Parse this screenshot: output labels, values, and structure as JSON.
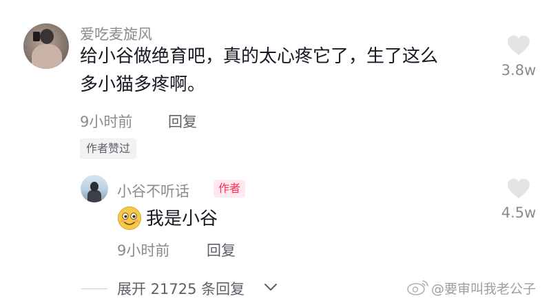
{
  "comment1": {
    "username": "爱吃麦旋风",
    "text_line1": "给小谷做绝育吧，真的太心疼它了，生了这么",
    "text_line2": "多小猫多疼啊。",
    "time": "9小时前",
    "reply_label": "回复",
    "liked_badge": "作者赞过",
    "likes": "3.8w"
  },
  "reply1": {
    "username": "小谷不听话",
    "author_badge": "作者",
    "text": "我是小谷",
    "emoji": "smiling-face-emoji",
    "time": "9小时前",
    "reply_label": "回复",
    "likes": "4.5w"
  },
  "expand": {
    "label": "展开 21725 条回复"
  },
  "watermark": {
    "text": "@要审叫我老公子"
  },
  "icons": {
    "like": "heart-icon",
    "expand": "chevron-down-icon",
    "watermark_logo": "weibo-logo"
  },
  "colors": {
    "author_badge": "#fe2c55",
    "secondary_text": "#8a8b91",
    "heart": "#e3e4e6"
  }
}
